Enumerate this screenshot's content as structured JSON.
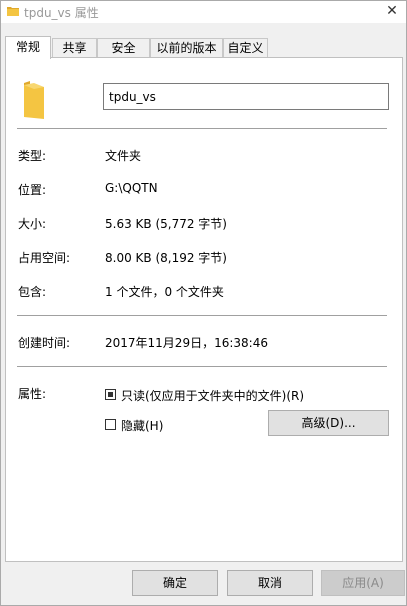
{
  "window": {
    "title": "tpdu_vs 属性",
    "close_glyph": "✕"
  },
  "tabs": [
    {
      "label": "常规"
    },
    {
      "label": "共享"
    },
    {
      "label": "安全"
    },
    {
      "label": "以前的版本"
    },
    {
      "label": "自定义"
    }
  ],
  "general": {
    "name_value": "tpdu_vs",
    "type_label": "类型:",
    "type_value": "文件夹",
    "location_label": "位置:",
    "location_value": "G:\\QQTN",
    "size_label": "大小:",
    "size_value": "5.63 KB (5,772 字节)",
    "disk_size_label": "占用空间:",
    "disk_size_value": "8.00 KB (8,192 字节)",
    "contains_label": "包含:",
    "contains_value": "1 个文件，0 个文件夹",
    "created_label": "创建时间:",
    "created_value": "2017年11月29日，16:38:46",
    "attributes_label": "属性:",
    "readonly_label": "只读(仅应用于文件夹中的文件)(R)",
    "hidden_label": "隐藏(H)",
    "advanced_label": "高级(D)..."
  },
  "footer": {
    "ok_label": "确定",
    "cancel_label": "取消",
    "apply_label": "应用(A)"
  },
  "colors": {
    "folder": "#f4c542",
    "folder_dark": "#e0a92c"
  }
}
